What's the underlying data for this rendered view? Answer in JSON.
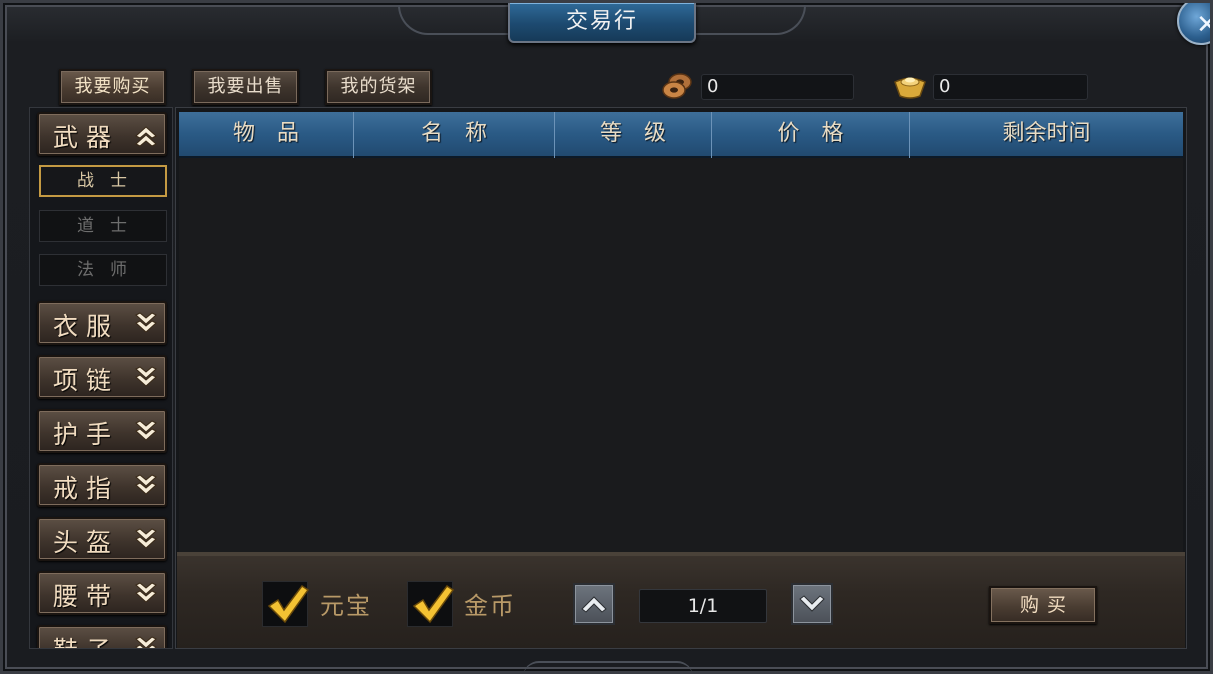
{
  "window": {
    "title": "交易行",
    "close_icon": "close-icon"
  },
  "tabs": [
    {
      "label": "我要购买",
      "active": true
    },
    {
      "label": "我要出售",
      "active": false
    },
    {
      "label": "我的货架",
      "active": false
    }
  ],
  "currency": {
    "copper": {
      "icon": "copper-coin-icon",
      "value": "0"
    },
    "ingot": {
      "icon": "gold-ingot-icon",
      "value": "0"
    }
  },
  "sidebar": {
    "categories": [
      {
        "label": "武器",
        "expanded": true,
        "subitems": [
          {
            "label": "战士",
            "active": true
          },
          {
            "label": "道士",
            "active": false
          },
          {
            "label": "法师",
            "active": false
          }
        ]
      },
      {
        "label": "衣服",
        "expanded": false
      },
      {
        "label": "项链",
        "expanded": false
      },
      {
        "label": "护手",
        "expanded": false
      },
      {
        "label": "戒指",
        "expanded": false
      },
      {
        "label": "头盔",
        "expanded": false
      },
      {
        "label": "腰带",
        "expanded": false
      },
      {
        "label": "鞋子",
        "expanded": false
      }
    ]
  },
  "table": {
    "columns": [
      "物　品",
      "名　称",
      "等　级",
      "价　格",
      "剩余时间"
    ],
    "rows": []
  },
  "footer": {
    "filter_yuanbao": {
      "label": "元宝",
      "checked": true
    },
    "filter_gold": {
      "label": "金币",
      "checked": true
    },
    "page_indicator": "1/1",
    "buy_label": "购买"
  },
  "colors": {
    "accent_blue": "#2a5a85",
    "button_brown": "#4a3c31",
    "label_gold": "#b99a68",
    "active_border": "#c49a43"
  }
}
